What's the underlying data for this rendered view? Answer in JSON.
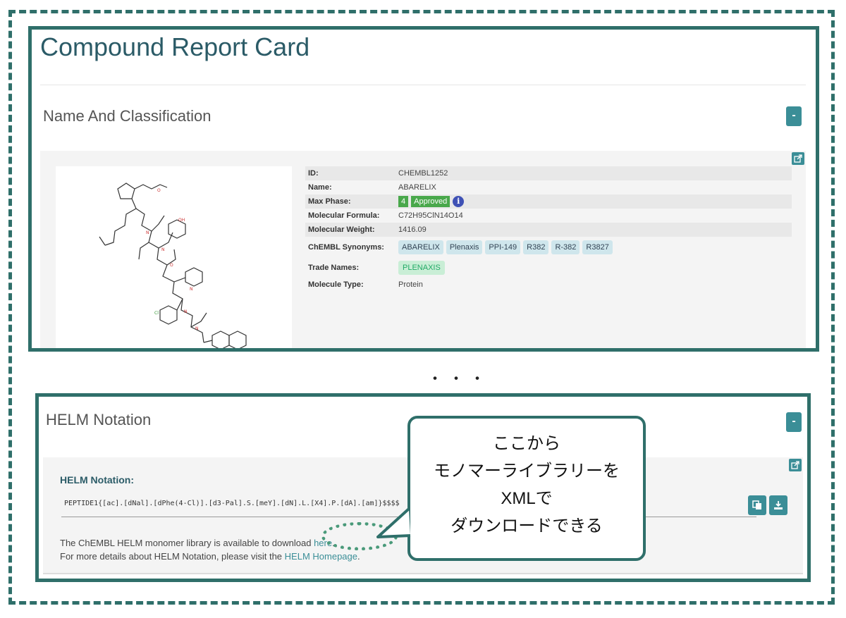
{
  "report": {
    "title": "Compound Report Card",
    "section_title": "Name And Classification",
    "collapse_label": "-",
    "properties": {
      "id_label": "ID:",
      "id_value": "CHEMBL1252",
      "name_label": "Name:",
      "name_value": "ABARELIX",
      "phase_label": "Max Phase:",
      "phase_number": "4",
      "phase_status": "Approved",
      "info_glyph": "i",
      "formula_label": "Molecular Formula:",
      "formula_value": "C72H95ClN14O14",
      "weight_label": "Molecular Weight:",
      "weight_value": "1416.09",
      "synonyms_label": "ChEMBL Synonyms:",
      "synonyms": [
        "ABARELIX",
        "Plenaxis",
        "PPI-149",
        "R382",
        "R-382",
        "R3827"
      ],
      "trade_label": "Trade Names:",
      "trade_value": "PLENAXIS",
      "type_label": "Molecule Type:",
      "type_value": "Protein"
    }
  },
  "separator": "・・・",
  "helm": {
    "section_title": "HELM Notation",
    "collapse_label": "-",
    "label": "HELM Notation:",
    "notation": "PEPTIDE1{[ac].[dNal].[dPhe(4-Cl)].[d3-Pal].S.[meY].[dN].L.[X4].P.[dA].[am]}$$$$",
    "library_text": "The ChEMBL HELM monomer library is available to download",
    "library_link": "here",
    "library_end": ".",
    "details_text": "For more details about HELM Notation, please visit the",
    "details_link": "HELM Homepage",
    "details_end": "."
  },
  "callout": {
    "lines": [
      "ここから",
      "モノマーライブラリーを",
      "XMLで",
      "ダウンロードできる"
    ]
  },
  "icons": [
    "share-icon",
    "copy-icon",
    "download-icon",
    "info-icon",
    "molecule-structure-image"
  ],
  "colors": {
    "accent": "#3b8e97",
    "frame": "#2f6f6a",
    "approved": "#49a84b",
    "chip": "#cfe6ec"
  }
}
